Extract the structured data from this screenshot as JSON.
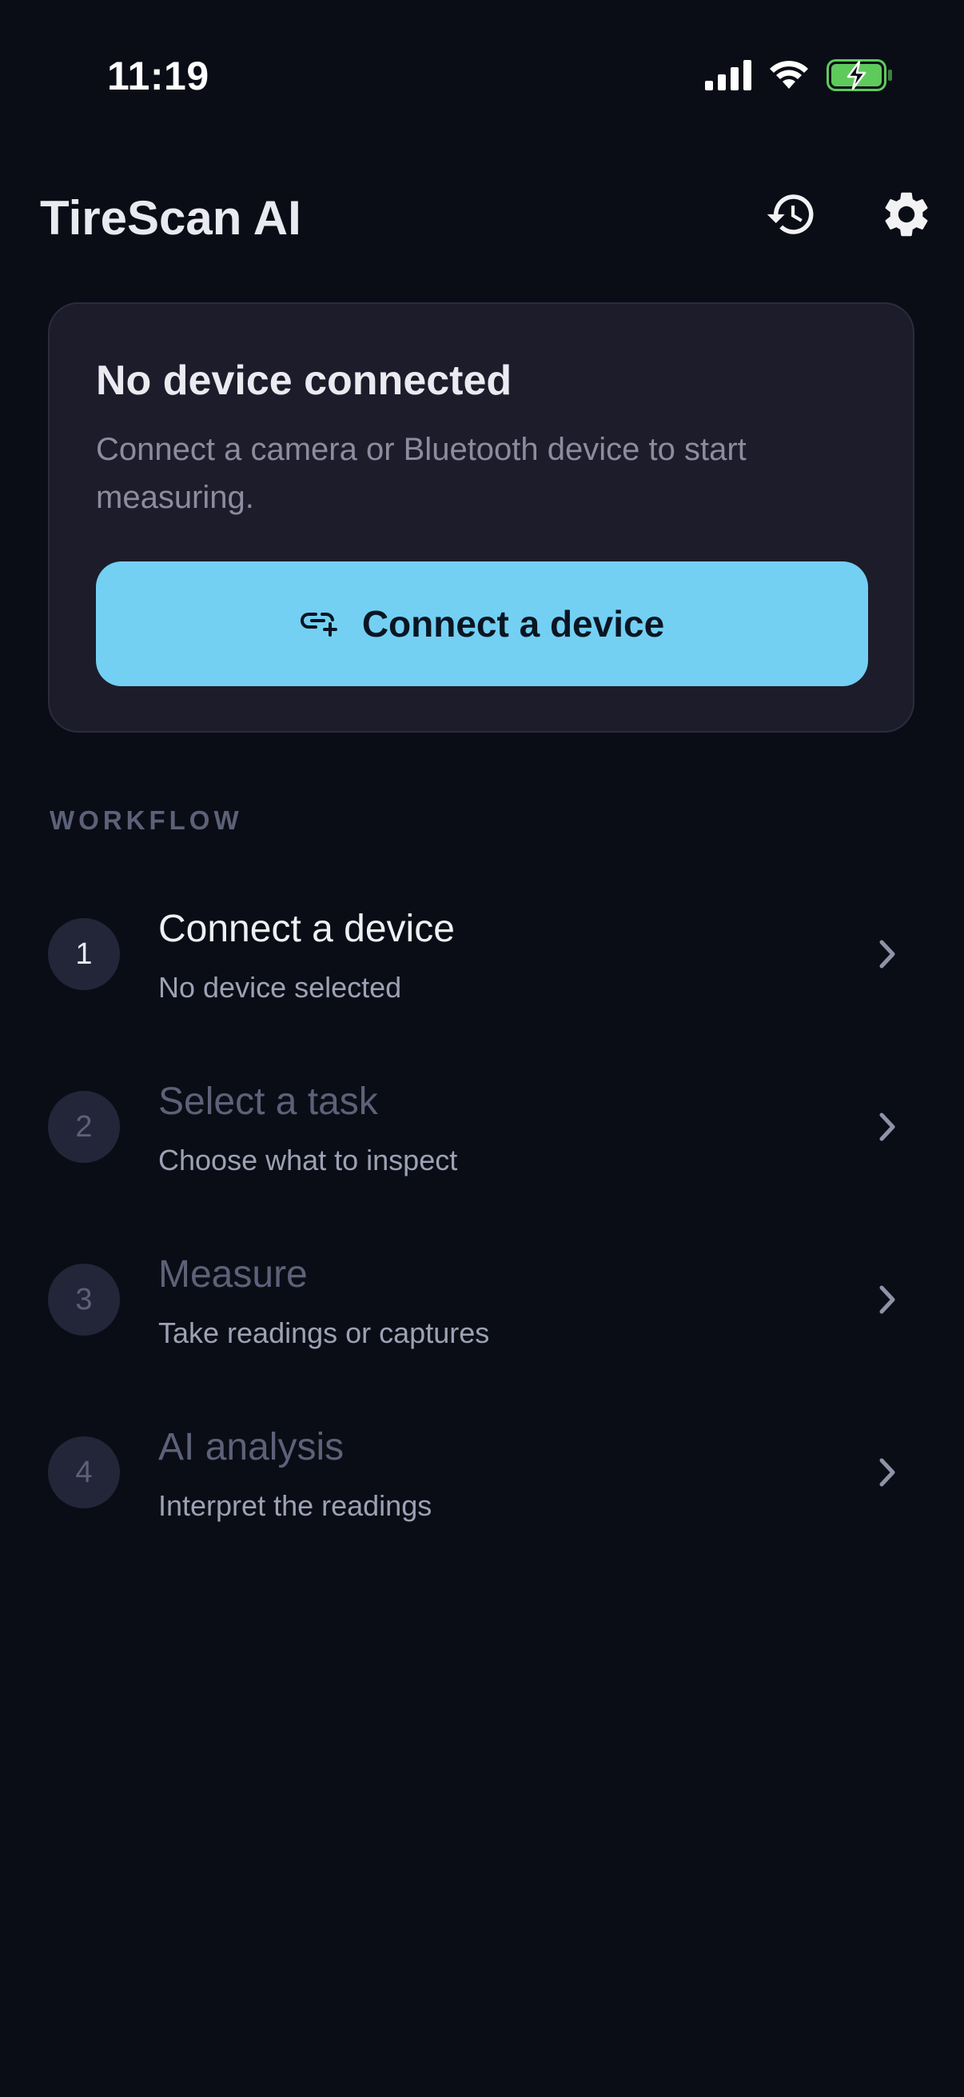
{
  "status_bar": {
    "time": "11:19",
    "icons": [
      "cellular-signal-icon",
      "wifi-icon",
      "battery-charging-icon"
    ],
    "battery_color": "#5fca5c"
  },
  "header": {
    "title": "TireScan AI",
    "icons": [
      "history-icon",
      "gear-icon"
    ]
  },
  "device_card": {
    "title": "No device connected",
    "description": "Connect a camera or Bluetooth device to start measuring.",
    "button_label": "Connect a device",
    "button_icon": "link-add-icon",
    "button_color": "#73d0f3"
  },
  "workflow": {
    "label": "WORKFLOW",
    "steps": [
      {
        "number": "1",
        "title": "Connect a device",
        "subtitle": "No device selected",
        "active": true
      },
      {
        "number": "2",
        "title": "Select a task",
        "subtitle": "Choose what to inspect",
        "active": false
      },
      {
        "number": "3",
        "title": "Measure",
        "subtitle": "Take readings or captures",
        "active": false
      },
      {
        "number": "4",
        "title": "AI analysis",
        "subtitle": "Interpret the readings",
        "active": false
      }
    ]
  },
  "colors": {
    "background": "#0a0d16",
    "card": "#1d1c2b",
    "accent": "#73d0f3"
  }
}
